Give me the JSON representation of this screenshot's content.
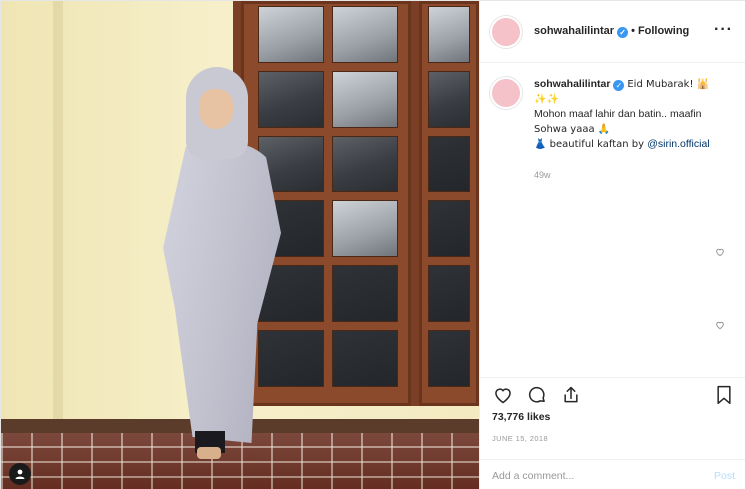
{
  "post": {
    "username": "sohwahalilintar",
    "verified": true,
    "follow_state": "Following",
    "separator": "•",
    "more_icon": "more-options-icon",
    "caption": {
      "line1": "Eid Mubarak! 🕌",
      "line1b": "✨✨",
      "line2": "Mohon maaf lahir dan batin.. maafin",
      "line3": "Sohwa yaaa 🙏",
      "line4_prefix": "👗 beautiful kaftan by ",
      "mention": "@sirin.official"
    },
    "time_ago": "49w",
    "likes": "73,776 likes",
    "date": "JUNE 15, 2018",
    "comment_placeholder": "Add a comment...",
    "post_button": "Post"
  },
  "colors": {
    "accent_blue": "#3897f0",
    "avatar_pink": "#f4c2c8",
    "post_disabled": "#b2dffc",
    "muted_text": "#999999"
  },
  "icons": {
    "like": "heart-icon",
    "comment": "comment-icon",
    "share": "share-icon",
    "save": "bookmark-icon",
    "tagged_user": "user-tag-icon",
    "comment_like": "heart-outline-icon"
  }
}
